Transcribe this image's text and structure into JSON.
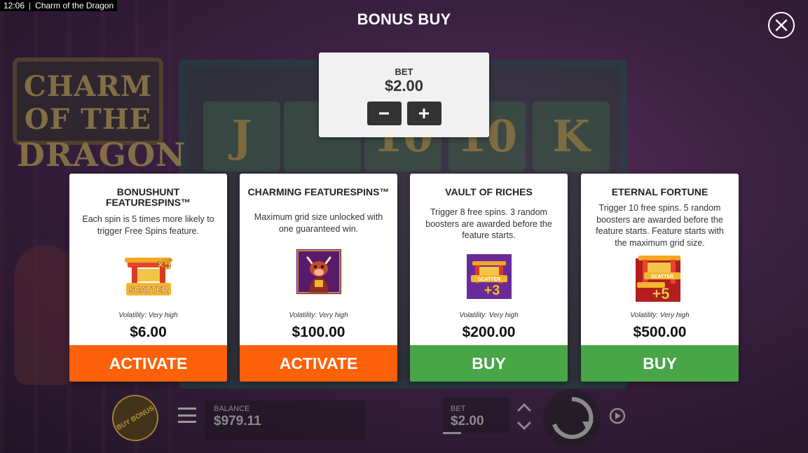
{
  "status_bar": {
    "time": "12:06",
    "separator": "|",
    "window_title": "Charm of the Dragon"
  },
  "background": {
    "logo_line1": "CHARM OF THE",
    "logo_line2": "DRAGON",
    "reel_symbols": [
      "J",
      "",
      "10",
      "10",
      "K"
    ]
  },
  "header": {
    "title": "BONUS BUY",
    "close_icon": "close-icon"
  },
  "bet_panel": {
    "label": "BET",
    "value": "$2.00",
    "decrease_icon": "minus-icon",
    "increase_icon": "plus-icon"
  },
  "cards": [
    {
      "title": "BONUSHUNT FEATURESPINS™",
      "description": "Each spin is 5 times more likely to trigger Free Spins feature.",
      "image_icon": "scatter-x5-icon",
      "image_text_main": "SCATTER",
      "image_text_badge": "×5",
      "volatility": "Volatility: Very high",
      "price": "$6.00",
      "action": "ACTIVATE",
      "action_color": "#fc6008"
    },
    {
      "title": "CHARMING FEATURESPINS™",
      "description": "Maximum grid size unlocked with one guaranteed win.",
      "image_icon": "ox-character-icon",
      "volatility": "Volatility: Very high",
      "price": "$100.00",
      "action": "ACTIVATE",
      "action_color": "#fc6008"
    },
    {
      "title": "VAULT OF RICHES",
      "description": "Trigger 8 free spins. 3 random boosters are awarded before the feature starts.",
      "image_icon": "scatter-plus3-icon",
      "image_text_main": "SCATTER",
      "image_text_badge": "+3",
      "volatility": "Volatility: Very high",
      "price": "$200.00",
      "action": "BUY",
      "action_color": "#48a646"
    },
    {
      "title": "ETERNAL FORTUNE",
      "description": "Trigger 10 free spins. 5 random boosters are awarded before the feature starts. Feature starts with the maximum grid size.",
      "image_icon": "scatter-plus5-icon",
      "image_text_main": "SCATTER",
      "image_text_badge": "+5",
      "volatility": "Volatility: Very high",
      "price": "$500.00",
      "action": "BUY",
      "action_color": "#48a646"
    }
  ],
  "bottom_bar": {
    "buy_bonus_label": "BUY BONUS",
    "menu_icon": "hamburger-menu-icon",
    "balance_label": "BALANCE",
    "balance_value": "$979.11",
    "bet_label": "BET",
    "bet_value": "$2.00",
    "bet_arrows_icon": "chevron-up-down-icon",
    "spin_icon": "spin-arrow-icon",
    "autoplay_icon": "autoplay-icon"
  }
}
